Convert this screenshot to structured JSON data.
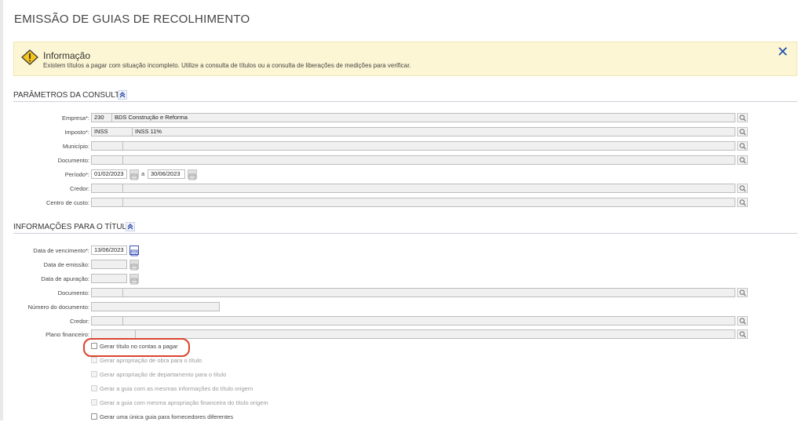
{
  "page": {
    "title": "EMISSÃO DE GUIAS DE RECOLHIMENTO"
  },
  "info": {
    "title": "Informação",
    "text": "Existem títulos a pagar com situação incompleto. Utilize a consulta de títulos ou a consulta de liberações de medições para verificar.",
    "close_symbol": "✕"
  },
  "section_params": {
    "title": "PARÂMETROS DA CONSULTA",
    "labels": {
      "empresa": "Empresa*:",
      "imposto": "Imposto*:",
      "municipio": "Município:",
      "documento": "Documento:",
      "periodo": "Período*:",
      "credor": "Credor:",
      "centro_custo": "Centro de custo:"
    },
    "values": {
      "empresa_code": "230",
      "empresa_name": "BDS Construção e Reforma",
      "imposto_code": "INSS",
      "imposto_name": "INSS 11%",
      "periodo_start": "01/02/2023",
      "periodo_sep": "a",
      "periodo_end": "30/06/2023"
    }
  },
  "section_titulo": {
    "title": "INFORMAÇÕES PARA O TÍTULO",
    "labels": {
      "data_vencimento": "Data de vencimento*:",
      "data_emissao": "Data de emissão:",
      "data_apuracao": "Data de apuração:",
      "documento": "Documento:",
      "numero_documento": "Número do documento:",
      "credor": "Credor:",
      "plano_financeiro": "Plano financeiro:"
    },
    "values": {
      "data_vencimento": "13/06/2023"
    },
    "checkboxes": [
      {
        "label": "Gerar título no contas a pagar",
        "enabled": true
      },
      {
        "label": "Gerar apropriação de obra para o título",
        "enabled": false
      },
      {
        "label": "Gerar apropriação de departamento para o título",
        "enabled": false
      },
      {
        "label": "Gerar a guia com as mesmas informações do título origem",
        "enabled": false
      },
      {
        "label": "Gerar a guia com mesma apropriação financeira do título origem",
        "enabled": false
      },
      {
        "label": "Gerar uma única guia para fornecedores diferentes",
        "enabled": true
      }
    ]
  },
  "colors": {
    "info_bg": "#fcf6d4",
    "accent": "#2050a8",
    "highlight": "#d9442e"
  }
}
